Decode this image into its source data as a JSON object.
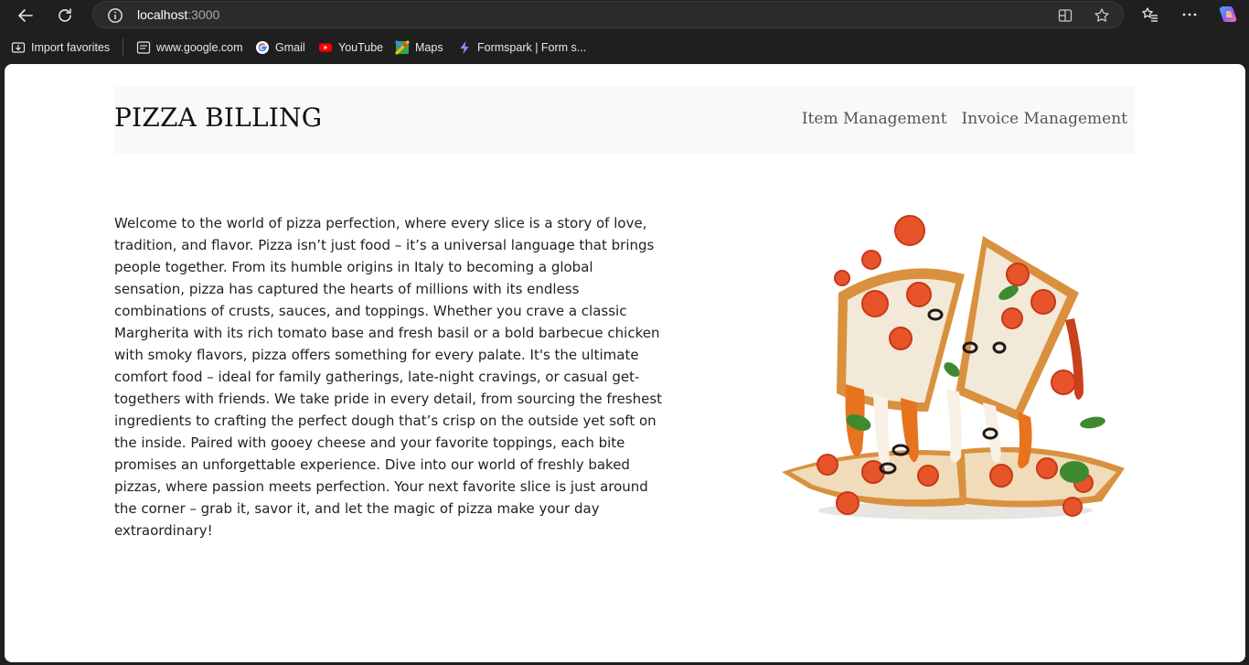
{
  "browser": {
    "url_host": "localhost",
    "url_port": ":3000",
    "icons": [
      "back-arrow-icon",
      "refresh-icon",
      "info-icon",
      "split-screen-icon",
      "star-icon",
      "favorites-icon",
      "more-icon",
      "copilot-icon"
    ]
  },
  "bookmarks": [
    {
      "label": "Import favorites",
      "icon": "import-icon"
    },
    {
      "label": "www.google.com",
      "icon": "page-icon"
    },
    {
      "label": "Gmail",
      "icon": "google-icon"
    },
    {
      "label": "YouTube",
      "icon": "youtube-icon"
    },
    {
      "label": "Maps",
      "icon": "maps-icon"
    },
    {
      "label": "Formspark | Form s...",
      "icon": "formspark-icon"
    }
  ],
  "navbar": {
    "brand": "PIZZA BILLING",
    "links": [
      "Item Management",
      "Invoice Management"
    ]
  },
  "intro": {
    "text": "Welcome to the world of pizza perfection, where every slice is a story of love, tradition, and flavor. Pizza isn’t just food – it’s a universal language that brings people together. From its humble origins in Italy to becoming a global sensation, pizza has captured the hearts of millions with its endless combinations of crusts, sauces, and toppings. Whether you crave a classic Margherita with its rich tomato base and fresh basil or a bold barbecue chicken with smoky flavors, pizza offers something for every palate. It's the ultimate comfort food – ideal for family gatherings, late-night cravings, or casual get-togethers with friends. We take pride in every detail, from sourcing the freshest ingredients to crafting the perfect dough that’s crisp on the outside yet soft on the inside. Paired with gooey cheese and your favorite toppings, each bite promises an unforgettable experience. Dive into our world of freshly baked pizzas, where passion meets perfection. Your next favorite slice is just around the corner – grab it, savor it, and let the magic of pizza make your day extraordinary!"
  },
  "colors": {
    "chrome_bg": "#1f1f1f",
    "navbar_bg": "#f8f9fa",
    "tomato": "#e8542a",
    "cheese": "#f3e9d8",
    "sauce_orange": "#e8731f"
  }
}
